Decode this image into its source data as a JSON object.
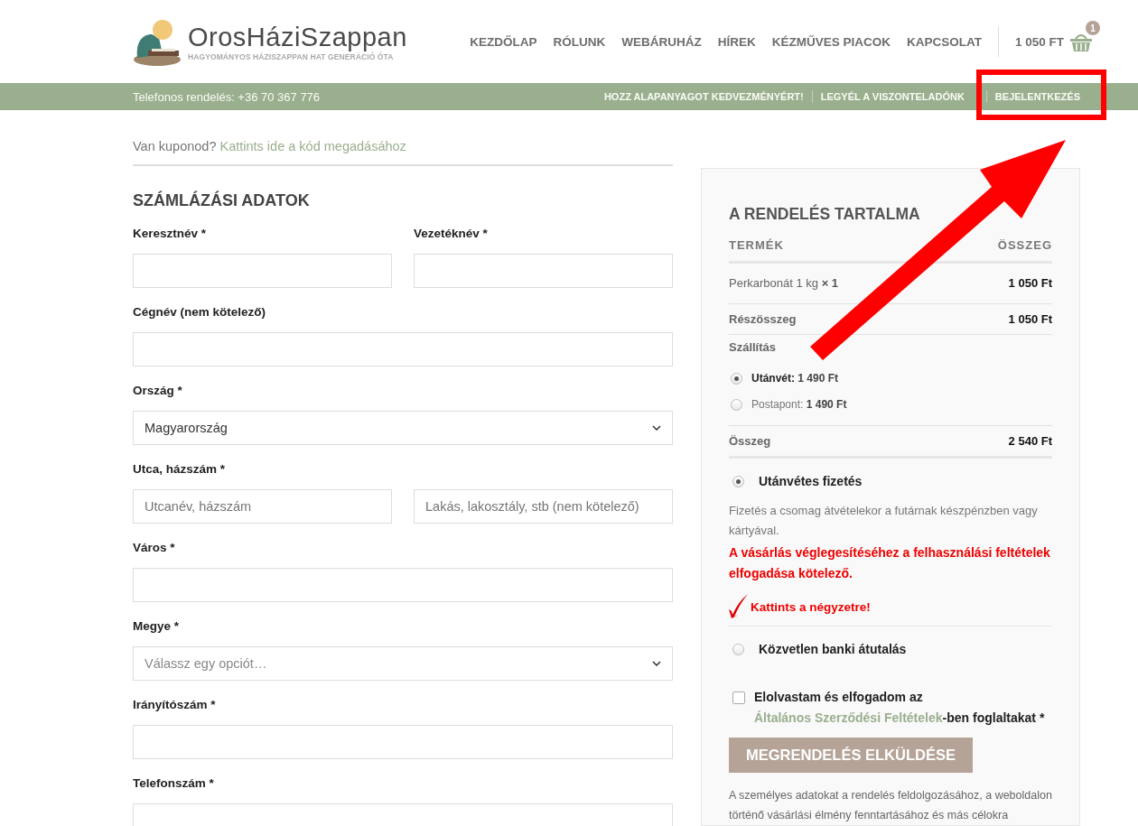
{
  "header": {
    "logo": {
      "name": "OrosHáziSzappan",
      "tagline": "HAGYOMÁNYOS HÁZISZAPPAN HAT GENERÁCIÓ ÓTA"
    },
    "nav": [
      "KEZDŐLAP",
      "RÓLUNK",
      "WEBÁRUHÁZ",
      "HÍREK",
      "KÉZMŰVES PIACOK",
      "KAPCSOLAT"
    ],
    "cart": {
      "total": "1 050 FT",
      "count": "1"
    }
  },
  "top_bar": {
    "phone": "Telefonos rendelés: +36 70 367 776",
    "links": [
      "HOZZ ALAPANYAGOT KEDVEZMÉNYÉRT!",
      "LEGYÉL A VISZONTELADÓNK",
      "BEJELENTKEZÉS"
    ]
  },
  "coupon": {
    "prompt": "Van kuponod?",
    "link": "Kattints ide a kód megadásához"
  },
  "billing": {
    "title": "SZÁMLÁZÁSI ADATOK",
    "rows": [
      [
        {
          "label": "Keresztnév *",
          "kind": "text"
        },
        {
          "label": "Vezetéknév *",
          "kind": "text"
        }
      ],
      [
        {
          "label": "Cégnév (nem kötelező)",
          "kind": "text"
        }
      ],
      [
        {
          "label": "Ország *",
          "kind": "select",
          "value": "Magyarország"
        }
      ],
      [
        {
          "label": "Utca, házszám *",
          "kind": "text",
          "placeholder": "Utcanév, házszám"
        },
        {
          "kind": "text",
          "placeholder": "Lakás, lakosztály, stb (nem kötelező)"
        }
      ],
      [
        {
          "label": "Város *",
          "kind": "text"
        }
      ],
      [
        {
          "label": "Megye *",
          "kind": "select",
          "placeholder": "Válassz egy opciót…"
        }
      ],
      [
        {
          "label": "Irányítószám *",
          "kind": "text"
        }
      ],
      [
        {
          "label": "Telefonszám *",
          "kind": "text"
        }
      ]
    ]
  },
  "order": {
    "title": "A RENDELÉS TARTALMA",
    "columns": [
      "TERMÉK",
      "ÖSSZEG"
    ],
    "items": [
      {
        "name": "Perkarbonát 1 kg",
        "qty": "× 1",
        "total": "1 050 Ft"
      }
    ],
    "subtotal": {
      "label": "Részösszeg",
      "value": "1 050 Ft"
    },
    "shipping": {
      "label": "Szállítás",
      "options": [
        {
          "label": "Utánvét:",
          "price": "1 490 Ft",
          "selected": true
        },
        {
          "label": "Postapont:",
          "price": "1 490 Ft",
          "selected": false
        }
      ]
    },
    "total": {
      "label": "Összeg",
      "value": "2 540 Ft"
    },
    "payments": [
      {
        "label": "Utánvétes fizetés",
        "selected": true,
        "description": "Fizetés a csomag átvételekor a futárnak készpénzben vagy kártyával.",
        "warning": "A vásárlás véglegesítéséhez a felhasználási feltételek elfogadása kötelező.",
        "hint": "Kattints a négyzetre!"
      },
      {
        "label": "Közvetlen banki átutalás",
        "selected": false
      }
    ],
    "terms": {
      "before": "Elolvastam és elfogadom az",
      "link": "Általános Szerződési Feltételek",
      "after": "-ben foglaltakat *",
      "checked": false
    },
    "submit": "MEGRENDELÉS ELKÜLDÉSE",
    "privacy": "A személyes adatokat a rendelés feldolgozásához, a weboldalon történő vásárlási élmény fenntartásához és más célokra"
  },
  "annotation_marks": {
    "highlight_frame": true,
    "arrow": true
  }
}
